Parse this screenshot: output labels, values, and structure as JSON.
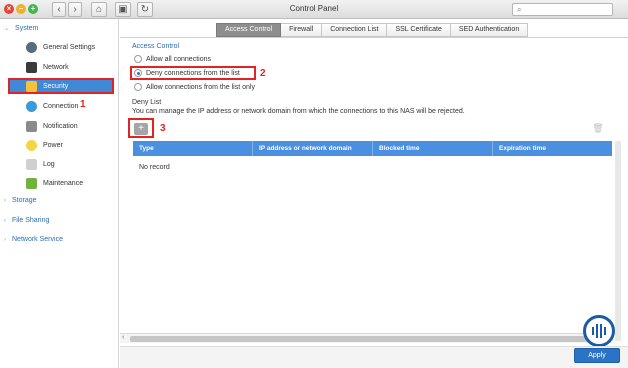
{
  "window": {
    "title": "Control Panel"
  },
  "search": {
    "placeholder": ""
  },
  "sidebar": {
    "system_label": "System",
    "items": [
      {
        "label": "General Settings",
        "icon": "gear-icon"
      },
      {
        "label": "Network",
        "icon": "network-icon"
      },
      {
        "label": "Security",
        "icon": "lock-icon"
      },
      {
        "label": "Connection",
        "icon": "globe-icon"
      },
      {
        "label": "Notification",
        "icon": "notification-icon"
      },
      {
        "label": "Power",
        "icon": "lightbulb-icon"
      },
      {
        "label": "Log",
        "icon": "log-icon"
      },
      {
        "label": "Maintenance",
        "icon": "tools-icon"
      }
    ],
    "sections": [
      "Storage",
      "File Sharing",
      "Network Service"
    ]
  },
  "tabs": [
    "Access Control",
    "Firewall",
    "Connection List",
    "SSL Certificate",
    "SED Authentication"
  ],
  "access_control": {
    "title": "Access Control",
    "options": [
      "Allow all connections",
      "Deny connections from the list",
      "Allow connections from the list only"
    ],
    "selected_index": 1
  },
  "deny_list": {
    "title": "Deny List",
    "description": "You can manage the IP address or network domain from which the connections to this NAS will be rejected.",
    "columns": [
      "Type",
      "IP address or network domain",
      "Blocked time",
      "Expiration time"
    ],
    "empty_text": "No record"
  },
  "annotations": {
    "one": "1",
    "two": "2",
    "three": "3"
  },
  "footer": {
    "apply_label": "Apply"
  },
  "colors": {
    "accent": "#2b73c7",
    "selection": "#3f89d6",
    "annotation_red": "#e32323"
  }
}
